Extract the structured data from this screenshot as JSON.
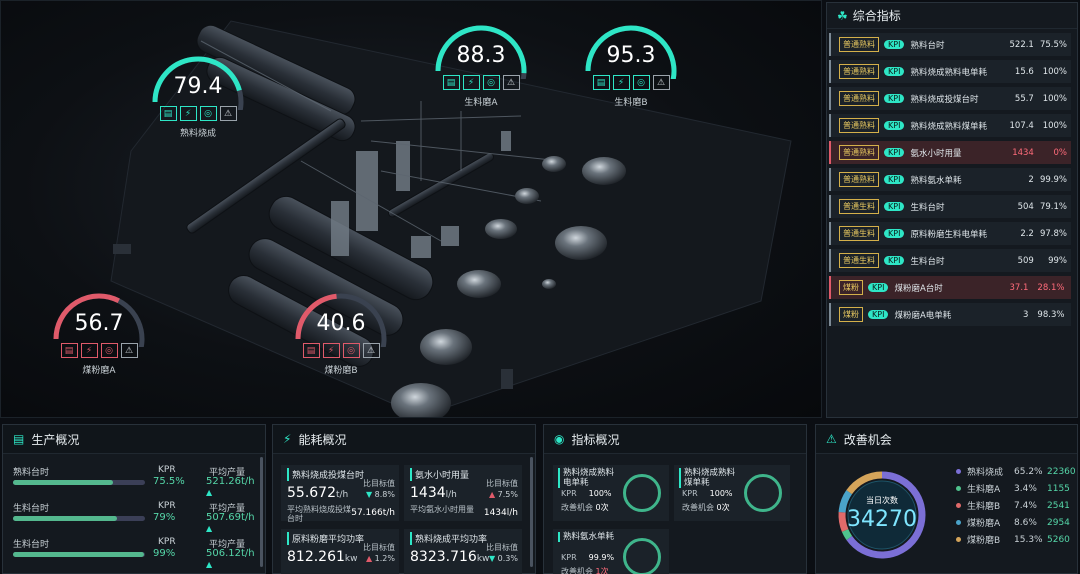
{
  "gauges": [
    {
      "name": "熟料烧成",
      "value": "79.4",
      "level": 79.4,
      "status": "normal"
    },
    {
      "name": "生料磨A",
      "value": "88.3",
      "level": 88.3,
      "status": "normal"
    },
    {
      "name": "生料磨B",
      "value": "95.3",
      "level": 95.3,
      "status": "normal"
    },
    {
      "name": "煤粉磨A",
      "value": "56.7",
      "level": 56.7,
      "status": "alert"
    },
    {
      "name": "煤粉磨B",
      "value": "40.6",
      "level": 40.6,
      "status": "alert"
    }
  ],
  "gauge_icons": [
    "trend-icon",
    "energy-icon",
    "index-icon",
    "warning-icon"
  ],
  "colors": {
    "accent": "#2ee6c6",
    "alert": "#e05a6a",
    "good": "#55d6a8"
  },
  "kpi_panel": {
    "title": "综合指标",
    "badge": "KPI",
    "rows": [
      {
        "tag": "普通熟料",
        "name": "熟料台时",
        "value": "522.1",
        "pct": "75.5%",
        "alert": false
      },
      {
        "tag": "普通熟料",
        "name": "熟料烧成熟料电单耗",
        "value": "15.6",
        "pct": "100%",
        "alert": false
      },
      {
        "tag": "普通熟料",
        "name": "熟料烧成投煤台时",
        "value": "55.7",
        "pct": "100%",
        "alert": false
      },
      {
        "tag": "普通熟料",
        "name": "熟料烧成熟料煤单耗",
        "value": "107.4",
        "pct": "100%",
        "alert": false
      },
      {
        "tag": "普通熟料",
        "name": "氨水小时用量",
        "value": "1434",
        "pct": "0%",
        "alert": true
      },
      {
        "tag": "普通熟料",
        "name": "熟料氨水单耗",
        "value": "2",
        "pct": "99.9%",
        "alert": false
      },
      {
        "tag": "普通生料",
        "name": "生料台时",
        "value": "504",
        "pct": "79.1%",
        "alert": false
      },
      {
        "tag": "普通生料",
        "name": "原料粉磨生料电单耗",
        "value": "2.2",
        "pct": "97.8%",
        "alert": false
      },
      {
        "tag": "普通生料",
        "name": "生料台时",
        "value": "509",
        "pct": "99%",
        "alert": false
      },
      {
        "tag": "煤粉",
        "name": "煤粉磨A台时",
        "value": "37.1",
        "pct": "28.1%",
        "alert": true
      },
      {
        "tag": "煤粉",
        "name": "煤粉磨A电单耗",
        "value": "3",
        "pct": "98.3%",
        "alert": false
      }
    ]
  },
  "production": {
    "title": "生产概况",
    "rows": [
      {
        "label": "熟料台时",
        "kpr_label": "KPR",
        "avg_label": "平均产量",
        "kpr": "75.5%",
        "avg": "521.26t/h",
        "fill": 75.5
      },
      {
        "label": "生料台时",
        "kpr_label": "KPR",
        "avg_label": "平均产量",
        "kpr": "79%",
        "avg": "507.69t/h",
        "fill": 79
      },
      {
        "label": "生料台时",
        "kpr_label": "KPR",
        "avg_label": "平均产量",
        "kpr": "99%",
        "avg": "506.12t/h",
        "fill": 99
      }
    ]
  },
  "energy": {
    "title": "能耗概况",
    "cells": [
      {
        "title": "熟料烧成投煤台时",
        "target_label": "比目标值",
        "value": "55.672",
        "unit": "t/h",
        "change": "8.8%",
        "dir": "down",
        "sub_label": "平均熟料烧成投煤台时",
        "sub_value": "57.166t/h"
      },
      {
        "title": "氨水小时用量",
        "target_label": "比目标值",
        "value": "1434",
        "unit": "l/h",
        "change": "7.5%",
        "dir": "up",
        "sub_label": "平均氨水小时用量",
        "sub_value": "1434l/h"
      },
      {
        "title": "原料粉磨平均功率",
        "target_label": "比目标值",
        "value": "812.261",
        "unit": "kw",
        "change": "1.2%",
        "dir": "up"
      },
      {
        "title": "熟料烧成平均功率",
        "target_label": "比目标值",
        "value": "8323.716",
        "unit": "kw",
        "change": "0.3%",
        "dir": "down"
      }
    ]
  },
  "index": {
    "title": "指标概况",
    "cells": [
      {
        "title": "熟料烧成熟料电单耗",
        "kpr_label": "KPR",
        "kpr": "100%",
        "chance_label": "改善机会",
        "chance": "0次"
      },
      {
        "title": "熟料烧成熟料煤单耗",
        "kpr_label": "KPR",
        "kpr": "100%",
        "chance_label": "改善机会",
        "chance": "0次"
      },
      {
        "title": "熟料氨水单耗",
        "kpr_label": "KPR",
        "kpr": "99.9%",
        "chance_label": "改善机会",
        "chance": "1次"
      }
    ]
  },
  "improve": {
    "title": "改善机会",
    "center_label": "当日次数",
    "center_value": "34270",
    "items": [
      {
        "name": "熟料烧成",
        "pct": "65.2%",
        "share": 65.2,
        "count": "22360",
        "color": "#7b6fd6"
      },
      {
        "name": "生料磨A",
        "pct": "3.4%",
        "share": 3.4,
        "count": "1155",
        "color": "#4fc38d"
      },
      {
        "name": "生料磨B",
        "pct": "7.4%",
        "share": 7.4,
        "count": "2541",
        "color": "#e06a6a"
      },
      {
        "name": "煤粉磨A",
        "pct": "8.6%",
        "share": 8.6,
        "count": "2954",
        "color": "#4aa3c9"
      },
      {
        "name": "煤粉磨B",
        "pct": "15.3%",
        "share": 15.3,
        "count": "5260",
        "color": "#d4a45a"
      }
    ]
  }
}
